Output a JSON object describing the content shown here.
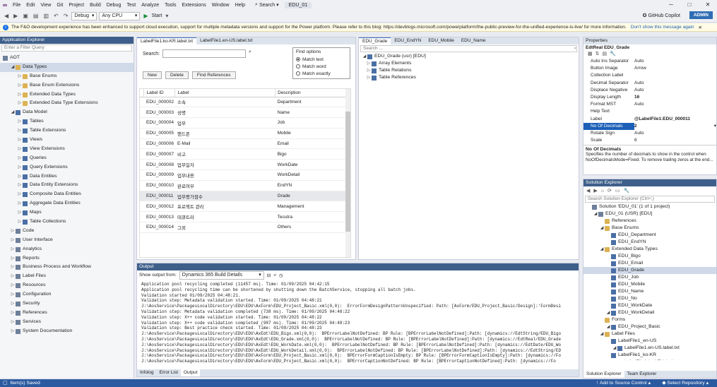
{
  "menu": {
    "items": [
      "File",
      "Edit",
      "View",
      "Git",
      "Project",
      "Build",
      "Debug",
      "Test",
      "Analyze",
      "Tools",
      "Extensions",
      "Window",
      "Help"
    ],
    "search_label": "Search",
    "solution_name": "EDU_01"
  },
  "toolbar": {
    "config": "Debug",
    "platform": "Any CPU",
    "start_label": "Start",
    "copilot_label": "GitHub Copilot",
    "admin_label": "ADMIN"
  },
  "infobar": {
    "message": "The F&O development experience has been enhanced to support cloud execution, support for multiple metadata versions and support for the Power platform. Please refer to this blog: https://devblogs.microsoft.com/powerplatform/the-public-preview-for-the-unified-experience-is-live/ for more information.",
    "dismiss": "Don't show this message again"
  },
  "app_explorer": {
    "title": "Application Explorer",
    "filter_placeholder": "Enter a Filter Query",
    "root": "AOT",
    "nodes": [
      {
        "label": "Data Types",
        "level": 1,
        "exp": "◢",
        "icon": "folder"
      },
      {
        "label": "Base Enums",
        "level": 2,
        "exp": "▷",
        "icon": "folder"
      },
      {
        "label": "Base Enum Extensions",
        "level": 2,
        "exp": "▷",
        "icon": "folder"
      },
      {
        "label": "Extended Data Types",
        "level": 2,
        "exp": "▷",
        "icon": "folder"
      },
      {
        "label": "Extended Data Type Extensions",
        "level": 2,
        "exp": "▷",
        "icon": "folder"
      },
      {
        "label": "Data Model",
        "level": 1,
        "exp": "◢",
        "icon": "grid"
      },
      {
        "label": "Tables",
        "level": 2,
        "exp": "▷",
        "icon": "grid"
      },
      {
        "label": "Table Extensions",
        "level": 2,
        "exp": "▷",
        "icon": "grid"
      },
      {
        "label": "Views",
        "level": 2,
        "exp": "▷",
        "icon": "grid"
      },
      {
        "label": "View Extensions",
        "level": 2,
        "exp": "▷",
        "icon": "grid"
      },
      {
        "label": "Queries",
        "level": 2,
        "exp": "▷",
        "icon": "grid"
      },
      {
        "label": "Query Extensions",
        "level": 2,
        "exp": "▷",
        "icon": "grid"
      },
      {
        "label": "Data Entities",
        "level": 2,
        "exp": "▷",
        "icon": "grid"
      },
      {
        "label": "Data Entity Extensions",
        "level": 2,
        "exp": "▷",
        "icon": "grid"
      },
      {
        "label": "Composite Data Entities",
        "level": 2,
        "exp": "▷",
        "icon": "grid"
      },
      {
        "label": "Aggregate Data Entities",
        "level": 2,
        "exp": "▷",
        "icon": "grid"
      },
      {
        "label": "Maps",
        "level": 2,
        "exp": "▷",
        "icon": "grid"
      },
      {
        "label": "Table Collections",
        "level": 2,
        "exp": "▷",
        "icon": "grid"
      },
      {
        "label": "Code",
        "level": 1,
        "exp": "▷",
        "icon": "node"
      },
      {
        "label": "User Interface",
        "level": 1,
        "exp": "▷",
        "icon": "node"
      },
      {
        "label": "Analytics",
        "level": 1,
        "exp": "▷",
        "icon": "node"
      },
      {
        "label": "Reports",
        "level": 1,
        "exp": "▷",
        "icon": "node"
      },
      {
        "label": "Business Process and Workflow",
        "level": 1,
        "exp": "▷",
        "icon": "node"
      },
      {
        "label": "Label Files",
        "level": 1,
        "exp": "▷",
        "icon": "node"
      },
      {
        "label": "Resources",
        "level": 1,
        "exp": "▷",
        "icon": "node"
      },
      {
        "label": "Configuration",
        "level": 1,
        "exp": "▷",
        "icon": "node"
      },
      {
        "label": "Security",
        "level": 1,
        "exp": "▷",
        "icon": "node"
      },
      {
        "label": "References",
        "level": 1,
        "exp": "▷",
        "icon": "node"
      },
      {
        "label": "Services",
        "level": 1,
        "exp": "▷",
        "icon": "node"
      },
      {
        "label": "System Documentation",
        "level": 1,
        "exp": "▷",
        "icon": "node"
      }
    ]
  },
  "label_editor": {
    "tabs": [
      "LabelFile1.ko-KR.label.txt",
      "LabelFile1.en-US.label.txt"
    ],
    "search_label": "Search:",
    "find_options_title": "Find options",
    "options": [
      "Match text",
      "Match word",
      "Match exactly"
    ],
    "buttons": [
      "New",
      "Delete",
      "Find References"
    ],
    "columns": [
      "Label ID",
      "Label",
      "Description"
    ],
    "rows": [
      [
        "EDU_000002",
        "소속",
        "Department"
      ],
      [
        "EDU_000003",
        "성명",
        "Name"
      ],
      [
        "EDU_000004",
        "업무",
        "Job"
      ],
      [
        "EDU_000005",
        "핸드폰",
        "Mobile"
      ],
      [
        "EDU_000006",
        "E-Mail",
        "Email"
      ],
      [
        "EDU_000007",
        "비고",
        "Bigo"
      ],
      [
        "EDU_000008",
        "업무일자",
        "WorkDate"
      ],
      [
        "EDU_000009",
        "업무내용",
        "WorkDetail"
      ],
      [
        "EDU_000010",
        "완료여부",
        "EndYN"
      ],
      [
        "EDU_000011",
        "업무평가점수",
        "Grade"
      ],
      [
        "EDU_000012",
        "프로젝트 관리",
        "Management"
      ],
      [
        "EDU_000013",
        "테큐트라",
        "Tecutra"
      ],
      [
        "EDU_000014",
        "그외",
        "Others"
      ]
    ]
  },
  "designer": {
    "tabs": [
      "EDU_Grade",
      "EDU_EndYN",
      "EDU_Mobile",
      "EDU_Name"
    ],
    "search_placeholder": "Search ...",
    "root": "EDU_Grade (usr) [EDU]",
    "children": [
      "Array Elements",
      "Table Relations",
      "Table References"
    ]
  },
  "properties": {
    "title": "Properties",
    "object": "EdtReal  EDU_Grade",
    "rows": [
      [
        "Auto Ins Separator",
        "Auto"
      ],
      [
        "Button Image",
        "Arrow"
      ],
      [
        "Collection Label",
        ""
      ],
      [
        "Decimal Separator",
        "Auto"
      ],
      [
        "Displace Negative",
        "Auto"
      ],
      [
        "Display Length",
        "16"
      ],
      [
        "Format MST",
        "Auto"
      ],
      [
        "Help Text",
        ""
      ],
      [
        "Label",
        "@LabelFile1:EDU_000011"
      ],
      [
        "No Of Decimals",
        "2"
      ],
      [
        "Rotate Sign",
        "Auto"
      ],
      [
        "Scale",
        "6"
      ]
    ],
    "desc_title": "No Of Decimals",
    "desc_text": "Specifies the number of decimals to show in the control when NoOfDecimalsMode=Fixed. To remove trailing zeros at the end..."
  },
  "solution_explorer": {
    "title": "Solution Explorer",
    "search_placeholder": "Search Solution Explorer (Ctrl+;)",
    "items": [
      {
        "label": "Solution 'EDU_01' (1 of 1 project)",
        "level": 0
      },
      {
        "label": "EDU_01 (USR) [EDU]",
        "level": 1
      },
      {
        "label": "References",
        "level": 2
      },
      {
        "label": "Base Enums",
        "level": 2
      },
      {
        "label": "EDU_Department",
        "level": 3
      },
      {
        "label": "EDU_EndYN",
        "level": 3
      },
      {
        "label": "Extended Data Types",
        "level": 2
      },
      {
        "label": "EDU_Bigo",
        "level": 3
      },
      {
        "label": "EDU_Email",
        "level": 3
      },
      {
        "label": "EDU_Grade",
        "level": 3
      },
      {
        "label": "EDU_Job",
        "level": 3
      },
      {
        "label": "EDU_Mobile",
        "level": 3
      },
      {
        "label": "EDU_Name",
        "level": 3
      },
      {
        "label": "EDU_No",
        "level": 3
      },
      {
        "label": "EDU_WorkDate",
        "level": 3
      },
      {
        "label": "EDU_WorkDetail",
        "level": 3
      },
      {
        "label": "Forms",
        "level": 2
      },
      {
        "label": "EDU_Project_Basic",
        "level": 3
      },
      {
        "label": "Label Files",
        "level": 2
      },
      {
        "label": "LabelFile1_en-US",
        "level": 3
      },
      {
        "label": "LabelFile1.en-US.label.txt",
        "level": 4
      },
      {
        "label": "LabelFile1_ko-KR",
        "level": 3
      },
      {
        "label": "LabelFile1.ko-KR.label.txt",
        "level": 4
      }
    ],
    "bottom_tabs": [
      "Solution Explorer",
      "Team Explorer"
    ]
  },
  "output": {
    "title": "Output",
    "show_from_label": "Show output from:",
    "source": "Dynamics 365 Build Details",
    "lines": [
      "Application pool recycling completed (11457 ms). Time: 01/09/2025 04:42:15",
      "Application pool recycling time can be shortened by shutting down the BatchService, stopping all batch jobs.",
      "Validation started 01/09/2025 04:48:21.",
      "Validation step: Metadata validation started. Time: 01/09/2025 04:48:21",
      "J:\\AosService\\PackagesLocalDirectory\\EDU\\EDU\\AxForm\\EDU_Project_Basic.xml(0,0):  ErrorFormDesignPatternUnspecified: Path: [AxForm/EDU_Project_Basic/Design]:'FormDesi",
      "Validation step: Metadata validation completed (738 ms). Time: 01/09/2025 04:48:22",
      "Validation step: X++ code validation started. Time: 01/09/2025 04:48:22",
      "Validation step: X++ code validation completed (987 ms). Time: 01/09/2025 04:48:23",
      "Validation step: Best practice check started. Time: 01/09/2025 04:48:23",
      "J:\\AosService\\PackagesLocalDirectory\\EDU\\EDU\\AxEdt\\EDU_Bigo.xml(0,0):  BPErrorLabelNotDefined: BP Rule: [BPErrorLabelNotDefined]:Path: [dynamics://EdtString/EDU_Bigo",
      "J:\\AosService\\PackagesLocalDirectory\\EDU\\EDU\\AxEdt\\EDU_Grade.xml(0,0):  BPErrorLabelNotDefined: BP Rule: [BPErrorLabelNotDefined]:Path: [dynamics://EdtReal/EDU_Grade",
      "J:\\AosService\\PackagesLocalDirectory\\EDU\\EDU\\AxEdt\\EDU_WorkDate.xml(0,0):  BPErrorLabelNotDefined: BP Rule: [BPErrorLabelNotDefined]:Path: [dynamics://EdtDate/EDU_Wo",
      "J:\\AosService\\PackagesLocalDirectory\\EDU\\EDU\\AxEdt\\EDU_WorkDetail.xml(0,0):  BPErrorLabelNotDefined: BP Rule: [BPErrorLabelNotDefined]:Path: [dynamics://EdtString/ED",
      "J:\\AosService\\PackagesLocalDirectory\\EDU\\EDU\\AxForm\\EDU_Project_Basic.xml(0,0):  BPErrorFormCaptionIsEmpty: BP Rule: [BPErrorFormCaptionIsEmpty]:Path: [dynamics://Fo",
      "J:\\AosService\\PackagesLocalDirectory\\EDU\\EDU\\AxForm\\EDU_Project_Basic.xml(0,0):  BPErrorCaptionNotDefined: BP Rule: [BPErrorCaptionNotDefined]:Path: [dynamics://Fo"
    ],
    "bottom_tabs": [
      "Infolog",
      "Error List",
      "Output"
    ]
  },
  "status": {
    "left": "Item(s) Saved",
    "source_control": "Add to Source Control",
    "repo": "Select Repository"
  }
}
